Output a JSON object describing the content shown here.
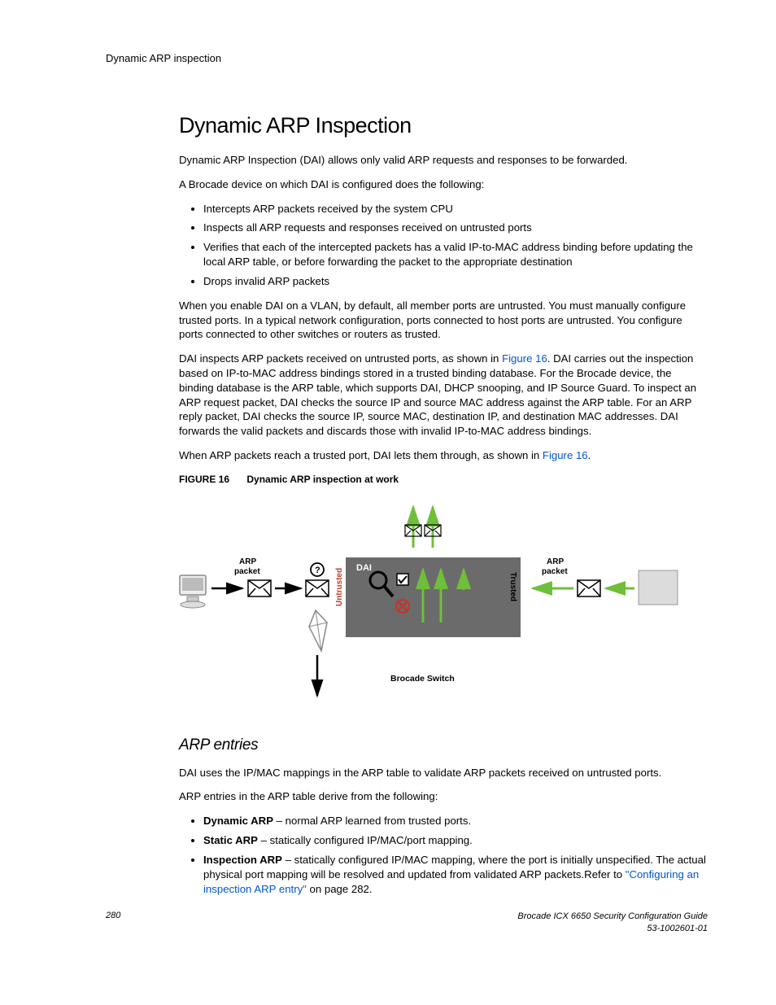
{
  "header": {
    "section": "Dynamic ARP inspection"
  },
  "title": "Dynamic ARP Inspection",
  "intro": {
    "p1": "Dynamic ARP Inspection (DAI) allows only valid ARP requests and responses to be forwarded.",
    "p2": "A Brocade device on which DAI is configured does the following:",
    "bullets": {
      "b1": "Intercepts ARP packets received by the system CPU",
      "b2": "Inspects all ARP requests and responses received on untrusted ports",
      "b3": "Verifies that each of the intercepted packets has a valid IP-to-MAC address binding before updating the local ARP table, or before forwarding the packet to the appropriate destination",
      "b4": "Drops invalid ARP packets"
    },
    "p3": "When you enable DAI on a VLAN, by default, all member ports are untrusted. You must manually configure trusted ports. In a typical network configuration, ports connected to host ports are untrusted. You configure ports connected to other switches or routers as trusted.",
    "p4a": "DAI inspects ARP packets received on untrusted ports, as shown in ",
    "p4link": "Figure 16",
    "p4b": ". DAI carries out the inspection based on IP-to-MAC address bindings stored in a trusted binding database. For the Brocade device, the binding database is the ARP table, which supports DAI, DHCP snooping, and IP Source Guard. To inspect an ARP request packet, DAI checks the source IP and source MAC address against the ARP table. For an ARP reply packet, DAI checks the source IP, source MAC, destination IP, and destination MAC addresses. DAI forwards the valid packets and discards those with invalid IP-to-MAC address bindings.",
    "p5a": "When ARP packets reach a trusted port, DAI lets them through, as shown in ",
    "p5link": "Figure 16",
    "p5b": "."
  },
  "figure": {
    "label": "FIGURE 16",
    "title": "Dynamic ARP inspection at work",
    "labels": {
      "arp_left": "ARP\npacket",
      "arp_right": "ARP\npacket",
      "untrusted": "Untrusted",
      "trusted": "Trusted",
      "dai": "DAI",
      "switch": "Brocade Switch"
    }
  },
  "arp_entries": {
    "heading": "ARP entries",
    "p1": "DAI uses the IP/MAC mappings in the ARP table to validate ARP packets received on untrusted ports.",
    "p2": "ARP entries in the ARP table derive from the following:",
    "items": {
      "i1_bold": "Dynamic ARP",
      "i1_rest": " – normal ARP learned from trusted ports.",
      "i2_bold": "Static ARP",
      "i2_rest": " – statically configured IP/MAC/port mapping.",
      "i3_bold": "Inspection ARP",
      "i3_rest_a": " – statically configured IP/MAC mapping, where the port is initially unspecified. The actual physical port mapping will be resolved and updated from validated ARP packets.Refer to ",
      "i3_link": "\"Configuring an inspection ARP entry\"",
      "i3_rest_b": " on page 282."
    }
  },
  "footer": {
    "page": "280",
    "guide": "Brocade ICX 6650 Security Configuration Guide",
    "docnum": "53-1002601-01"
  }
}
